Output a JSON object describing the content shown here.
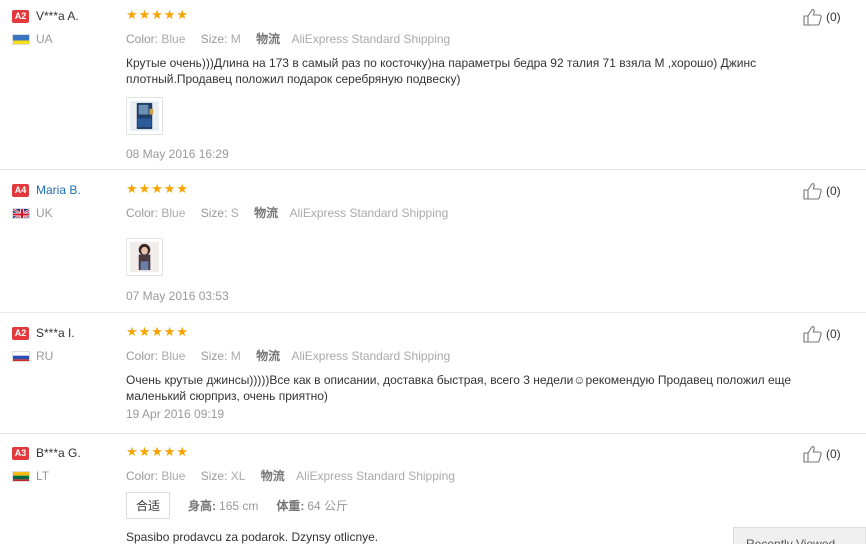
{
  "labels": {
    "color": "Color:",
    "size": "Size:",
    "logistics": "物流",
    "height": "身高:",
    "weight": "体重:"
  },
  "reviews": [
    {
      "badge": "A2",
      "name": "V***a A.",
      "country": "UA",
      "color": "Blue",
      "size": "M",
      "shipping": "AliExpress Standard Shipping",
      "text": "Крутые очень)))Длина на 173 в самый раз по косточку)на параметры бедра 92 талия 71 взяла М ,хорошо) Джинс плотный.Продавец положил подарок серебряную подвеску)",
      "date": "08 May 2016 16:29",
      "likes": "(0)"
    },
    {
      "badge": "A4",
      "name": "Maria B.",
      "country": "UK",
      "color": "Blue",
      "size": "S",
      "shipping": "AliExpress Standard Shipping",
      "text": "",
      "date": "07 May 2016 03:53",
      "likes": "(0)"
    },
    {
      "badge": "A2",
      "name": "S***a I.",
      "country": "RU",
      "color": "Blue",
      "size": "M",
      "shipping": "AliExpress Standard Shipping",
      "text": "Очень крутые джинсы)))))Все как в описании, доставка быстрая, всего 3 недели☺рекомендую   Продавец положил еще маленький сюрприз, очень приятно)",
      "date": "19 Apr 2016 09:19",
      "likes": "(0)"
    },
    {
      "badge": "A3",
      "name": "B***a G.",
      "country": "LT",
      "color": "Blue",
      "size": "XL",
      "shipping": "AliExpress Standard Shipping",
      "fit": "合适",
      "height": "165 cm",
      "weight": "64 公斤",
      "text": "Spasibo prodavcu za podarok. Dzynsy otlicnye.",
      "date": "",
      "likes": "(0)"
    }
  ],
  "recently_viewed": "Recently Viewed",
  "colors": {
    "star": "#f7a300",
    "badge": "#e4393c",
    "link": "#1d6fb8"
  },
  "icons": {
    "star": "star-icon",
    "like": "thumbs-up-icon"
  }
}
